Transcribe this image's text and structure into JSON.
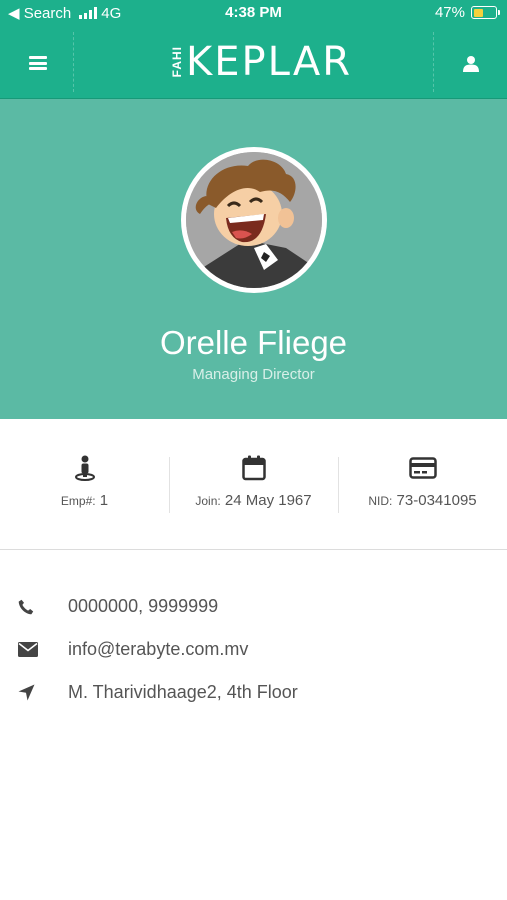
{
  "status_bar": {
    "back_label": "◀ Search",
    "network": "4G",
    "time": "4:38 PM",
    "battery": "47%",
    "battery_level": 0.47
  },
  "header": {
    "logo_small": "FAHI",
    "logo_main": "KEPLAR",
    "menu_icon": "hamburger-icon",
    "user_icon": "user-icon"
  },
  "profile": {
    "name": "Orelle Fliege",
    "title": "Managing Director"
  },
  "stats": {
    "emp": {
      "label": "Emp#:",
      "value": "1",
      "icon": "employee-icon"
    },
    "join": {
      "label": "Join:",
      "value": "24 May 1967",
      "icon": "calendar-icon"
    },
    "nid": {
      "label": "NID:",
      "value": "73-0341095",
      "icon": "id-card-icon"
    }
  },
  "contacts": {
    "phone": {
      "text": "0000000, 9999999",
      "icon": "phone-icon"
    },
    "email": {
      "text": "info@terabyte.com.mv",
      "icon": "envelope-icon"
    },
    "address": {
      "text": "M. Tharividhaage2, 4th Floor",
      "icon": "location-arrow-icon"
    }
  },
  "colors": {
    "primary": "#1db08c",
    "header_bg": "#5bbaa4",
    "text": "#555555"
  }
}
